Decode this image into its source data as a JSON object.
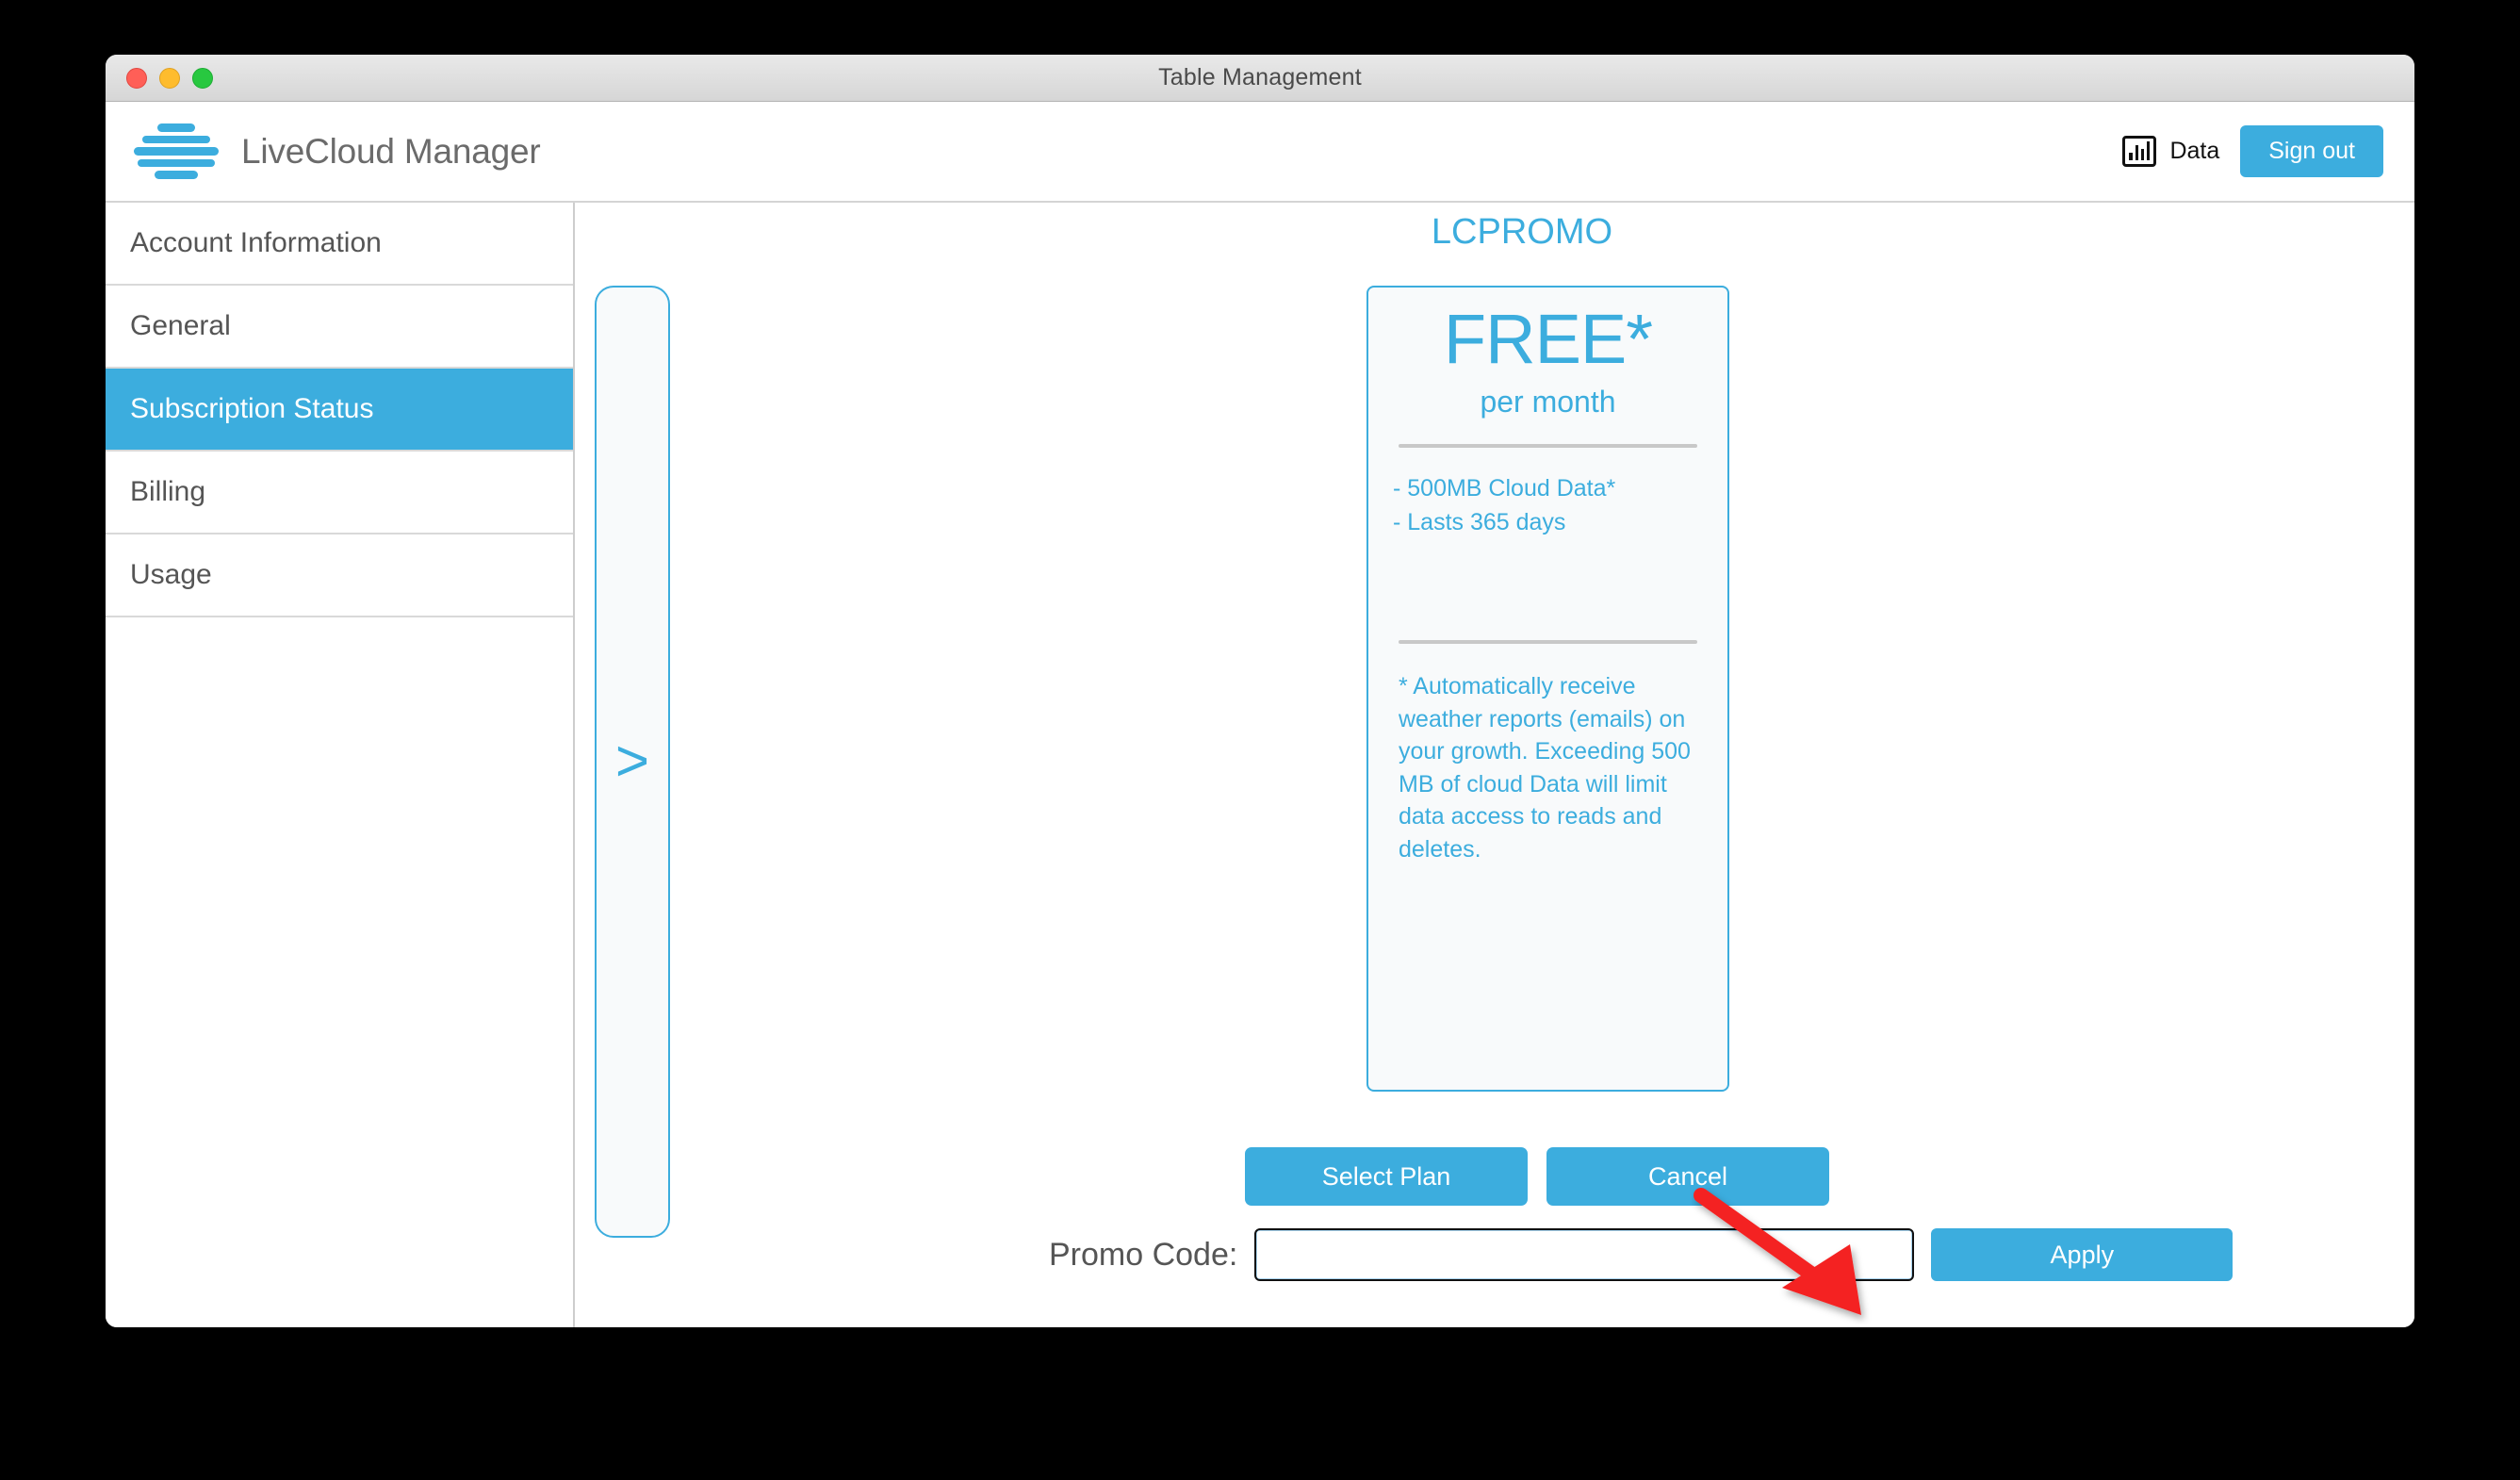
{
  "window": {
    "title": "Table Management",
    "controls": [
      "close",
      "minimize",
      "maximize"
    ]
  },
  "header": {
    "brand_name": "LiveCloud Manager",
    "logo_icon": "stacked-bars-logo",
    "data_label": "Data",
    "data_icon": "bar-chart-icon",
    "signout_label": "Sign out"
  },
  "sidebar": {
    "items": [
      {
        "label": "Account Information",
        "active": false
      },
      {
        "label": "General",
        "active": false
      },
      {
        "label": "Subscription Status",
        "active": true
      },
      {
        "label": "Billing",
        "active": false
      },
      {
        "label": "Usage",
        "active": false
      }
    ]
  },
  "main": {
    "nav_next_icon": ">",
    "plan": {
      "name": "LCPROMO",
      "price": "FREE*",
      "period": "per month",
      "features": [
        "- 500MB Cloud Data*",
        "- Lasts 365 days"
      ],
      "footnote": "* Automatically receive weather reports (emails) on your growth. Exceeding 500 MB of cloud Data will limit data access to reads and deletes."
    },
    "buttons": {
      "select_plan": "Select Plan",
      "cancel": "Cancel"
    },
    "promo": {
      "label": "Promo Code:",
      "value": "",
      "placeholder": "",
      "apply_label": "Apply"
    }
  },
  "annotation": {
    "arrow_color": "#f42222",
    "points_to": "Select Plan"
  },
  "colors": {
    "accent": "#3cadde",
    "sidebar_text": "#555555",
    "card_bg": "#f8fafb",
    "divider": "#c8c8c8"
  }
}
